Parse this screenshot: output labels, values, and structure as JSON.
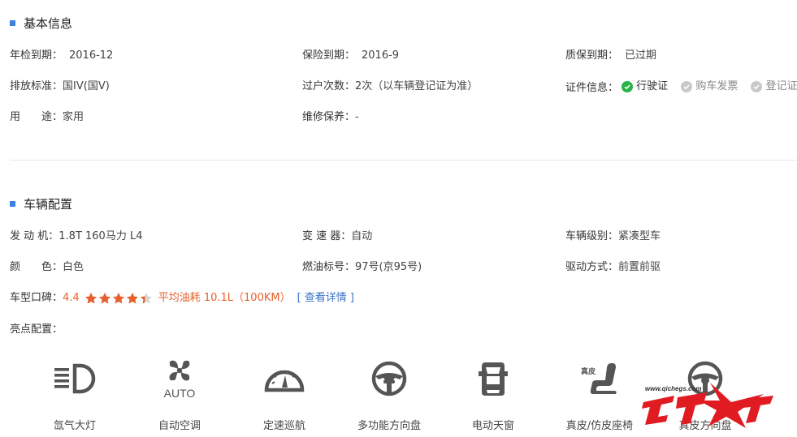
{
  "basic": {
    "title": "基本信息",
    "rows": [
      [
        {
          "label": "年检到期：",
          "value": "2016-12"
        },
        {
          "label": "保险到期：",
          "value": "2016-9"
        },
        {
          "label": "质保到期：",
          "value": "已过期"
        }
      ],
      [
        {
          "label": "排放标准：",
          "value": "国IV(国V)"
        },
        {
          "label": "过户次数：",
          "value": "2次（以车辆登记证为准）"
        },
        {
          "label": "证件信息：",
          "value": ""
        }
      ],
      [
        {
          "label": "用　　途：",
          "value": "家用"
        },
        {
          "label": "维修保养：",
          "value": "-"
        }
      ]
    ],
    "certs": [
      {
        "name": "行驶证",
        "status": "ok"
      },
      {
        "name": "购车发票",
        "status": "no"
      },
      {
        "name": "登记证",
        "status": "no"
      }
    ]
  },
  "config": {
    "title": "车辆配置",
    "rows": [
      [
        {
          "label": "发 动 机：",
          "value": "1.8T 160马力 L4"
        },
        {
          "label": "变 速 器：",
          "value": "自动"
        },
        {
          "label": "车辆级别：",
          "value": "紧凑型车"
        }
      ],
      [
        {
          "label": "颜　　色：",
          "value": "白色"
        },
        {
          "label": "燃油标号：",
          "value": "97号(京95号)"
        },
        {
          "label": "驱动方式：",
          "value": "前置前驱"
        }
      ]
    ],
    "rating": {
      "label": "车型口碑：",
      "score": "4.4",
      "stars": 4.4,
      "fuel": "平均油耗 10.1L（100KM）",
      "link": "[ 查看详情 ]"
    },
    "highlight_label": "亮点配置：",
    "features": [
      {
        "icon": "xenon-headlight-icon",
        "name": "氙气大灯",
        "badge": ""
      },
      {
        "icon": "auto-ac-fan-icon",
        "name": "自动空调",
        "badge": "AUTO"
      },
      {
        "icon": "cruise-control-gauge-icon",
        "name": "定速巡航",
        "badge": ""
      },
      {
        "icon": "multifunction-steering-wheel-icon",
        "name": "多功能方向盘",
        "badge": ""
      },
      {
        "icon": "sunroof-car-icon",
        "name": "电动天窗",
        "badge": ""
      },
      {
        "icon": "leather-seat-icon",
        "name": "真皮/仿皮座椅",
        "badge": "真皮"
      },
      {
        "icon": "leather-steering-wheel-icon",
        "name": "真皮方向盘",
        "badge": ""
      }
    ]
  },
  "watermark": {
    "url": "www.qichegs.com",
    "brand": "汽车之杠"
  },
  "colors": {
    "accent": "#3e82e0",
    "orange": "#e8612c",
    "link": "#3a72c8",
    "ok": "#27b24a",
    "icon": "#555555"
  }
}
